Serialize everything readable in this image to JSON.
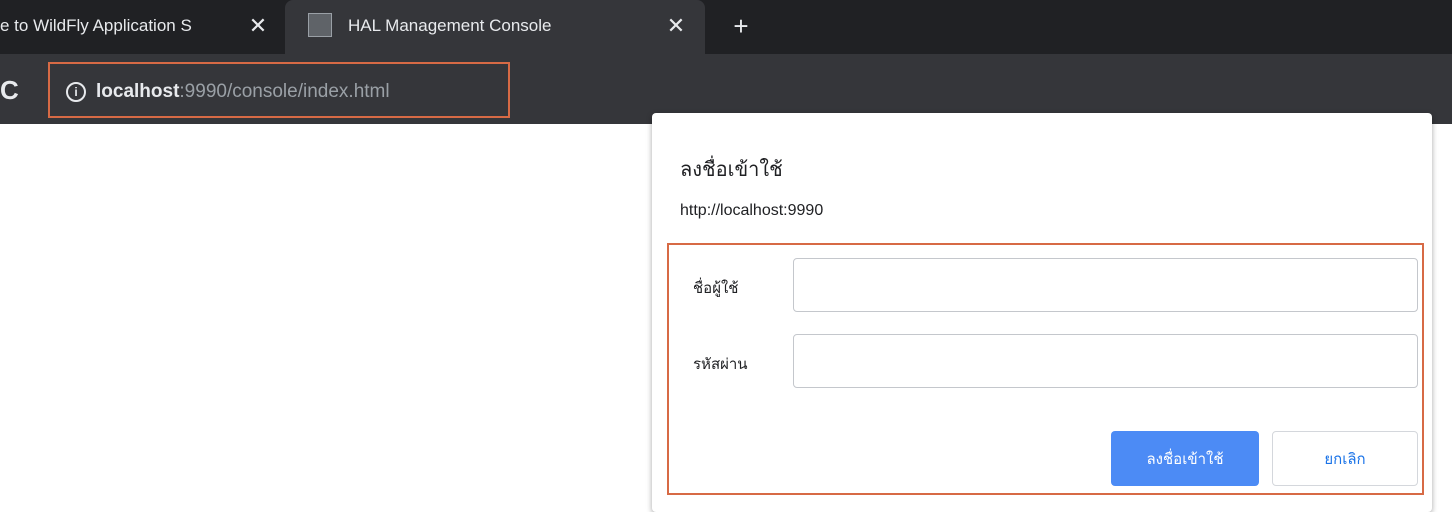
{
  "tabs": [
    {
      "title": "e to WildFly Application S",
      "close": "✕"
    },
    {
      "title": "HAL Management Console",
      "close": "✕"
    }
  ],
  "new_tab_label": "+",
  "toolbar": {
    "reload_glyph": "C",
    "info_glyph": "i",
    "url_host": "localhost",
    "url_rest": ":9990/console/index.html"
  },
  "dialog": {
    "title": "ลงชื่อเข้าใช้",
    "origin": "http://localhost:9990",
    "username_label": "ชื่อผู้ใช้",
    "username_value": "",
    "password_label": "รหัสผ่าน",
    "password_value": "",
    "sign_in_button": "ลงชื่อเข้าใช้",
    "cancel_button": "ยกเลิก"
  },
  "colors": {
    "tabstrip": "#202124",
    "toolbar": "#35363a",
    "highlight": "#d76a45",
    "primary": "#4c8bf5"
  },
  "icons": [
    "reload-icon",
    "info-icon",
    "favicon-icon",
    "close-icon",
    "plus-icon"
  ]
}
